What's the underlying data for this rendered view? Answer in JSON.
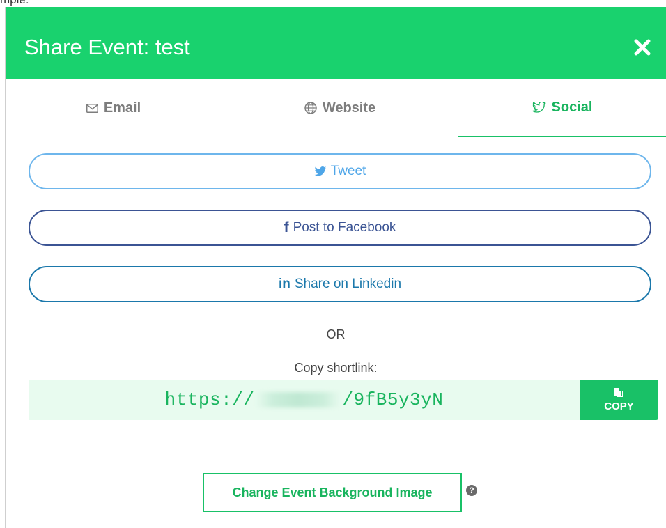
{
  "page_behind": {
    "partial_text": "mple:"
  },
  "modal": {
    "title": "Share Event: test",
    "close_label": "✕"
  },
  "tabs": [
    {
      "label": "Email",
      "icon": "envelope-icon",
      "active": false
    },
    {
      "label": "Website",
      "icon": "globe-icon",
      "active": false
    },
    {
      "label": "Social",
      "icon": "twitter-icon",
      "active": true
    }
  ],
  "social": {
    "tweet_label": "Tweet",
    "facebook_label": "Post to Facebook",
    "linkedin_label": "Share on Linkedin",
    "linkedin_icon_text": "in",
    "facebook_icon_text": "f"
  },
  "or_text": "OR",
  "shortlink": {
    "label": "Copy shortlink:",
    "prefix": "https://",
    "suffix": "/9fB5y3yN",
    "copy_label": "COPY"
  },
  "background_button_label": "Change Event Background Image",
  "help_icon_text": "?",
  "colors": {
    "accent": "#19d26e",
    "twitter": "#4fa6e8",
    "facebook": "#3b5494",
    "linkedin": "#1b78ab"
  }
}
